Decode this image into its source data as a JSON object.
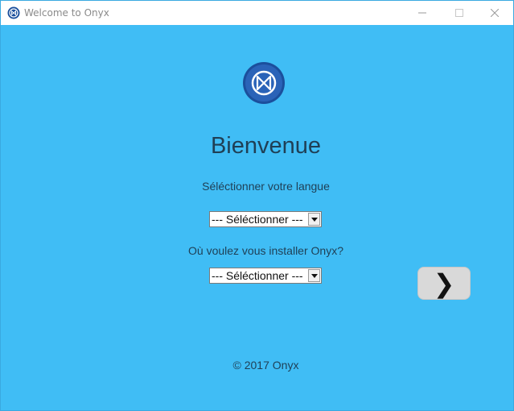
{
  "window": {
    "title": "Welcome to Onyx",
    "controls": {
      "minimize_icon": "minimize-icon",
      "maximize_icon": "maximize-icon",
      "close_icon": "close-icon"
    }
  },
  "main": {
    "logo_icon": "onyx-logo-icon",
    "heading": "Bienvenue",
    "language_label": "Séléctionner votre langue",
    "language_select_value": "--- Séléctionner ---",
    "install_location_label": "Où voulez vous installer Onyx?",
    "install_location_select_value": "--- Séléctionner ---",
    "next_button_label": "❯"
  },
  "footer": {
    "copyright": "© 2017 Onyx"
  },
  "colors": {
    "background": "#40bdf5",
    "text": "#1f3f55",
    "button": "#d9d9d9",
    "logo": "#1b4f9c"
  }
}
